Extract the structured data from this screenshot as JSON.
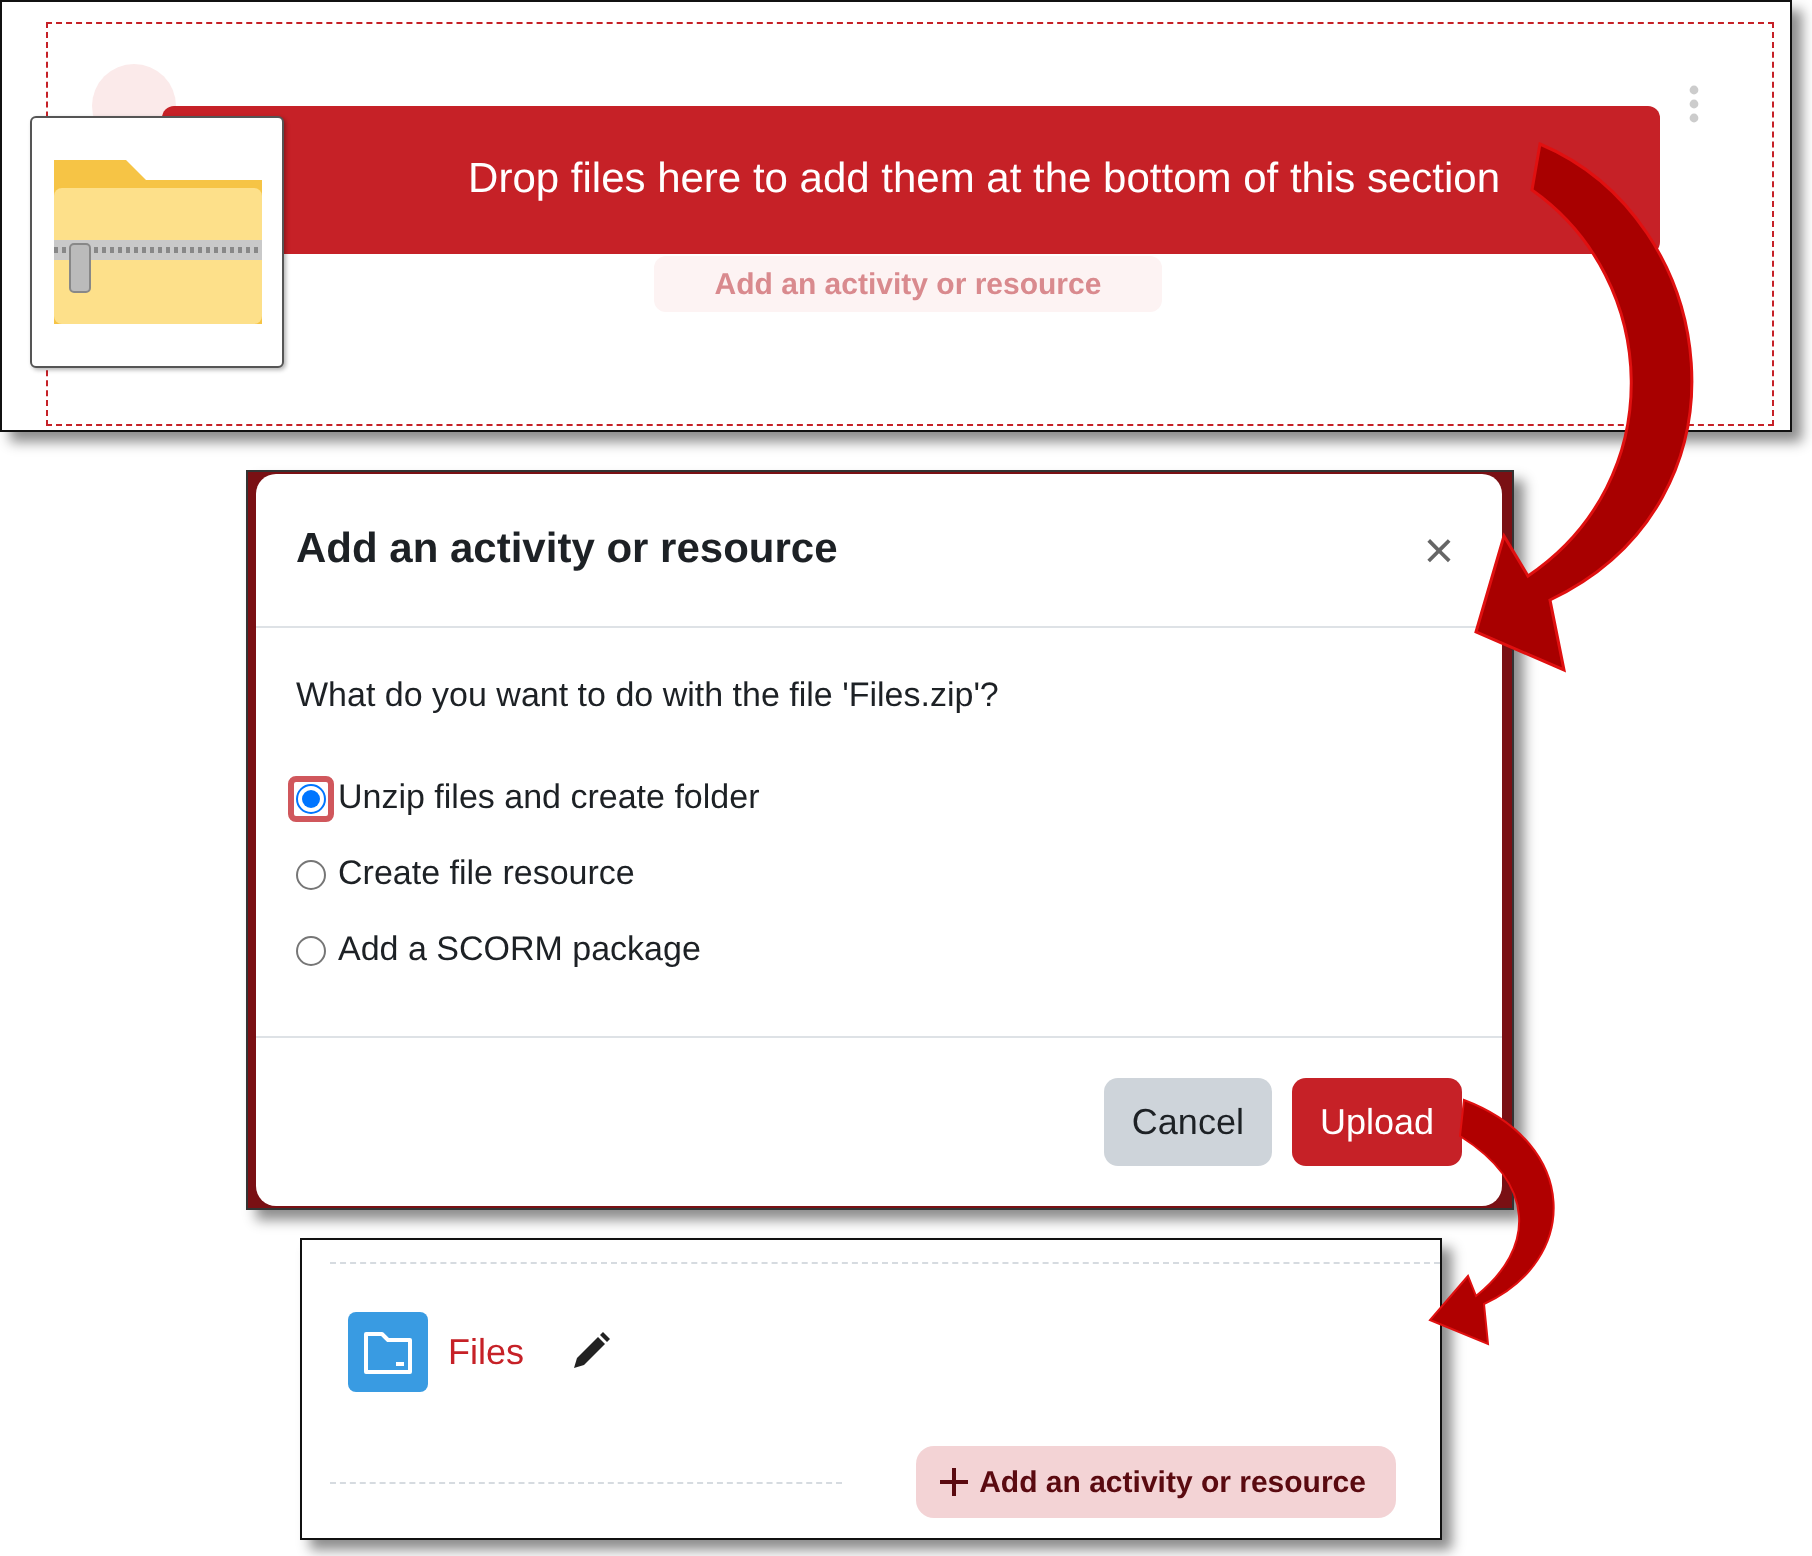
{
  "drop_zone": {
    "banner": "Drop files here to add them at the bottom of this section",
    "background_button": "Add an activity or resource"
  },
  "dialog": {
    "title": "Add an activity or resource",
    "close": "×",
    "question": "What do you want to do with the file 'Files.zip'?",
    "options": [
      {
        "label": "Unzip files and create folder",
        "selected": true
      },
      {
        "label": "Create file resource",
        "selected": false
      },
      {
        "label": "Add a SCORM package",
        "selected": false
      }
    ],
    "buttons": [
      {
        "label": "Cancel",
        "kind": "secondary"
      },
      {
        "label": "Upload",
        "kind": "primary"
      }
    ]
  },
  "result": {
    "items": [
      {
        "name": "Files"
      }
    ],
    "add_button": "Add an activity or resource"
  }
}
